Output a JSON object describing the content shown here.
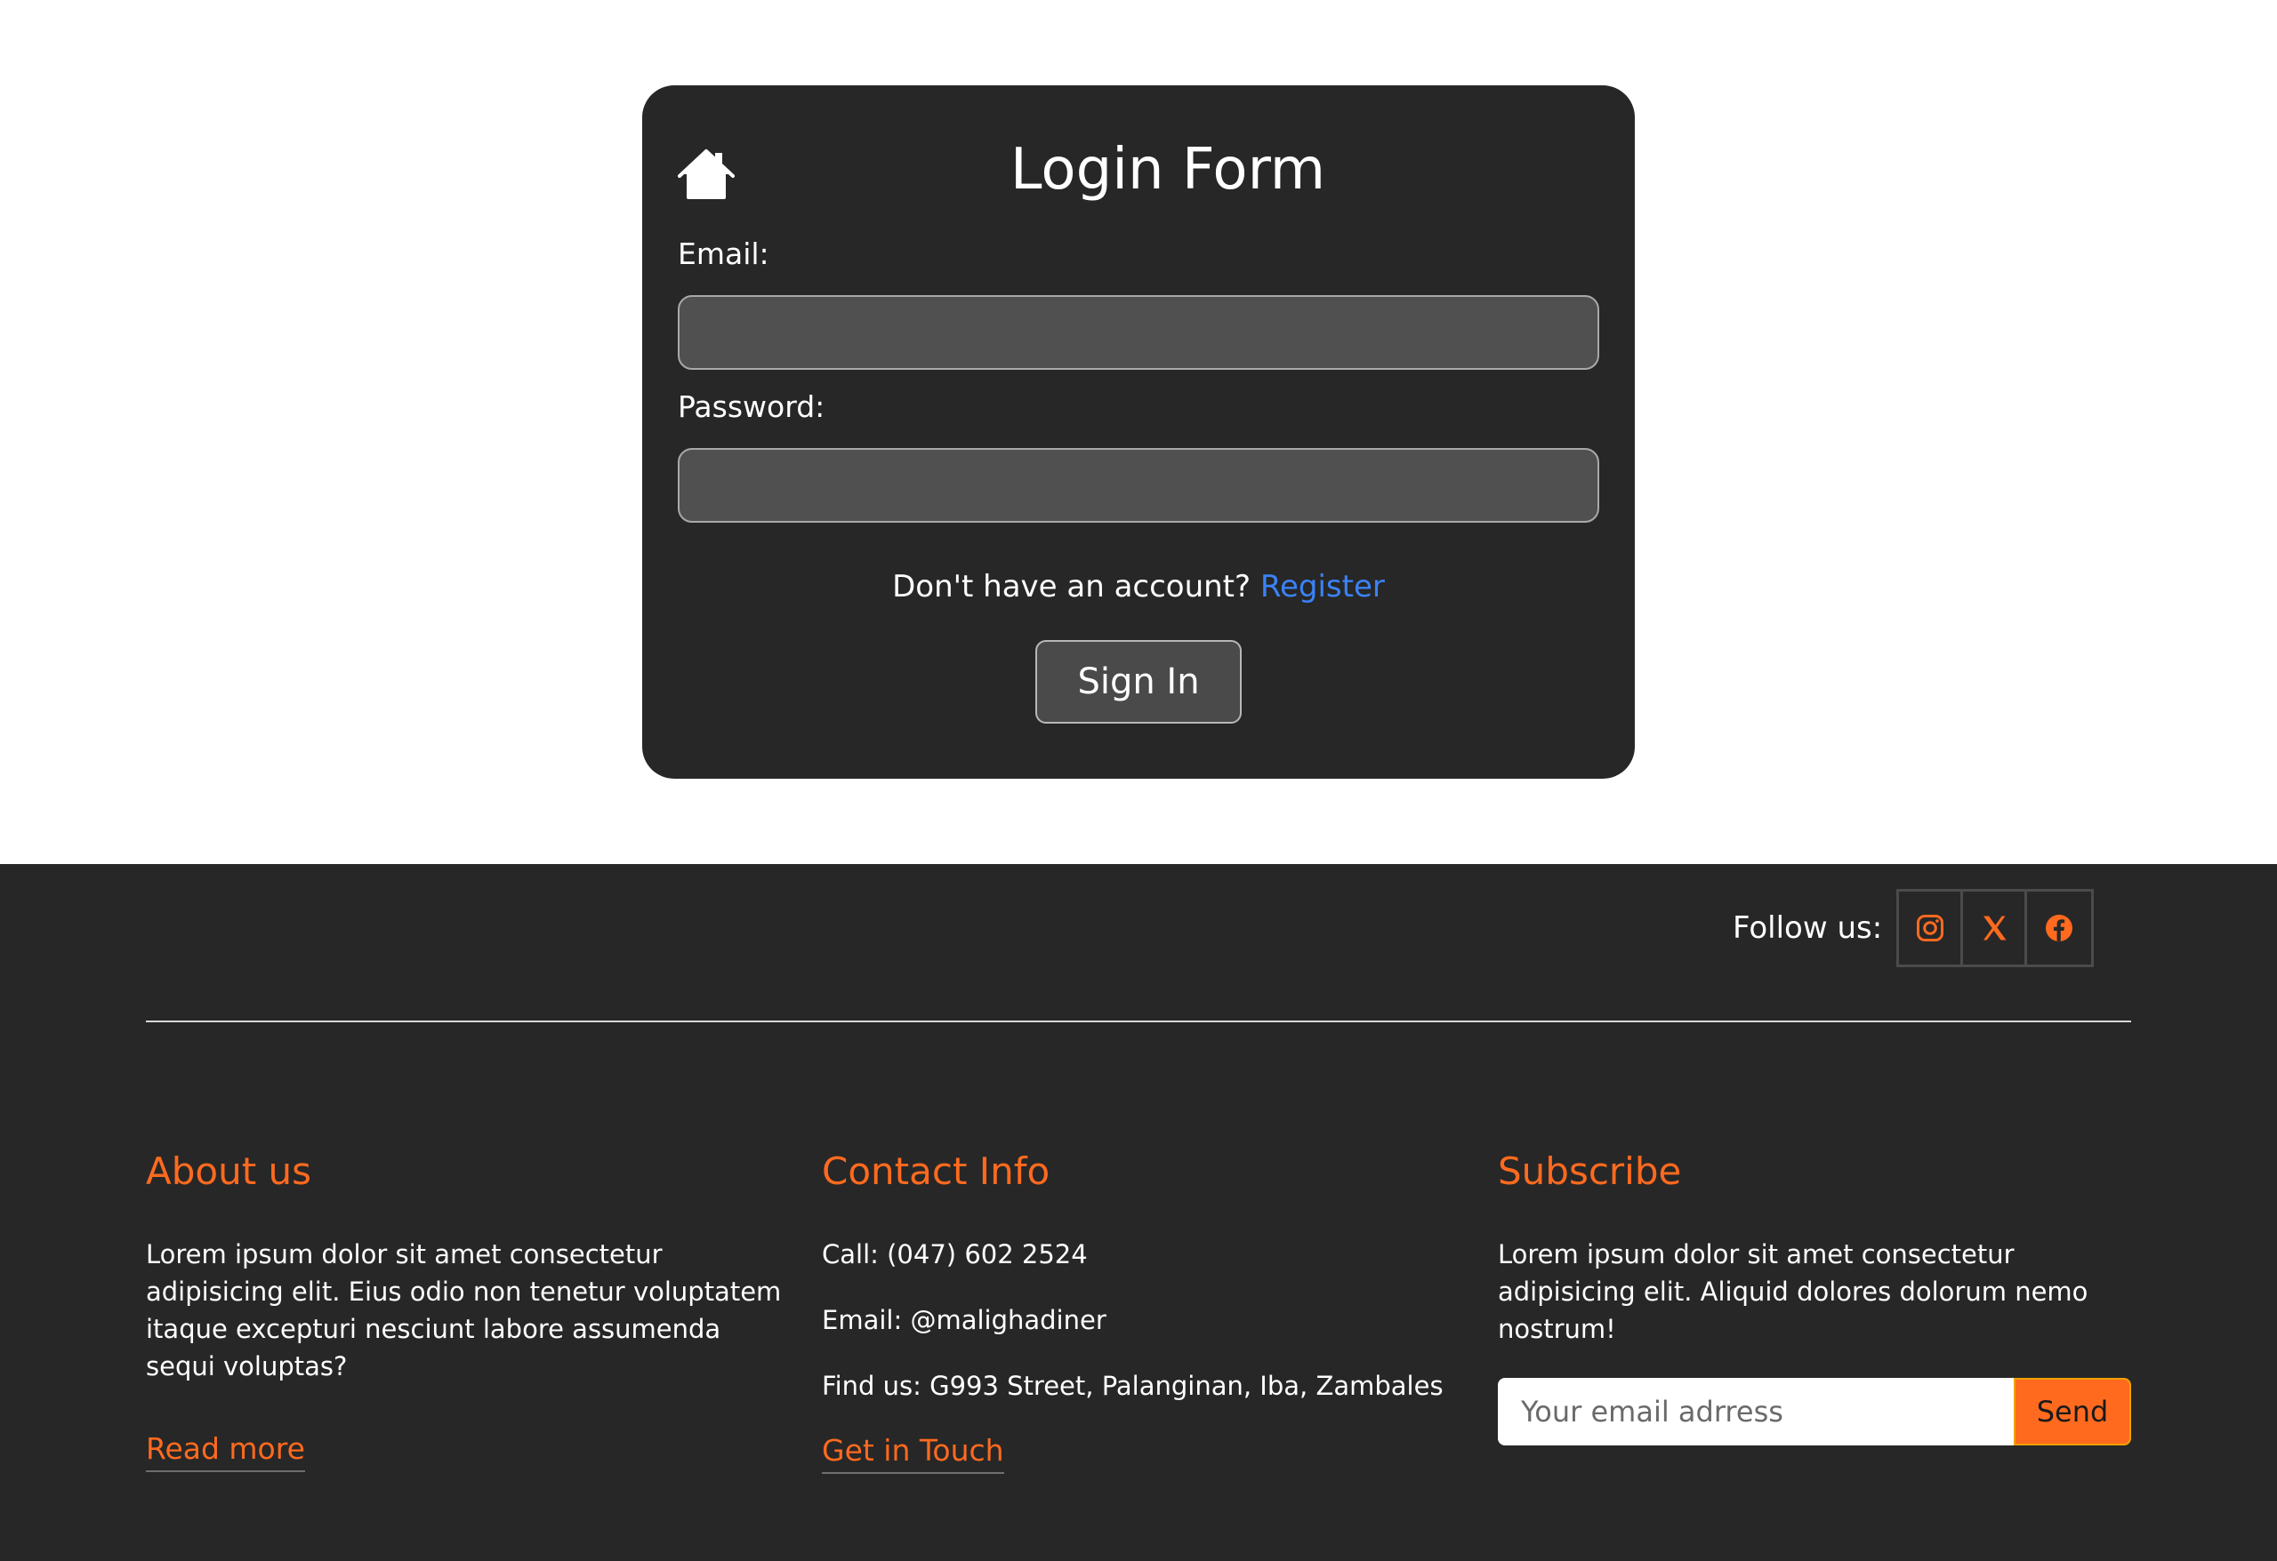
{
  "login": {
    "title": "Login Form",
    "home_icon": "home-icon",
    "email_label": "Email:",
    "email_value": "",
    "password_label": "Password:",
    "password_value": "",
    "register_prompt": "Don't have an account?",
    "register_link": "Register",
    "signin_label": "Sign In"
  },
  "footer": {
    "follow_label": "Follow us:",
    "social_icons": [
      "instagram-icon",
      "x-twitter-icon",
      "facebook-icon"
    ],
    "about": {
      "heading": "About us",
      "text": "Lorem ipsum dolor sit amet consectetur adipisicing elit. Eius odio non tenetur voluptatem itaque excepturi nesciunt labore assumenda sequi voluptas?",
      "link": "Read more"
    },
    "contact": {
      "heading": "Contact Info",
      "call": "Call: (047) 602 2524",
      "email": "Email: @malighadiner",
      "address": "Find us: G993 Street, Palanginan, Iba, Zambales",
      "link": "Get in Touch"
    },
    "subscribe": {
      "heading": "Subscribe",
      "text": "Lorem ipsum dolor sit amet consectetur adipisicing elit. Aliquid dolores dolorum nemo nostrum!",
      "input_placeholder": "Your email adrress",
      "input_value": "",
      "button": "Send"
    }
  },
  "colors": {
    "accent": "#ff6a1f",
    "card_bg": "#272727",
    "footer_bg": "#272727",
    "link_blue": "#3b82f6",
    "input_bg": "#505050"
  }
}
